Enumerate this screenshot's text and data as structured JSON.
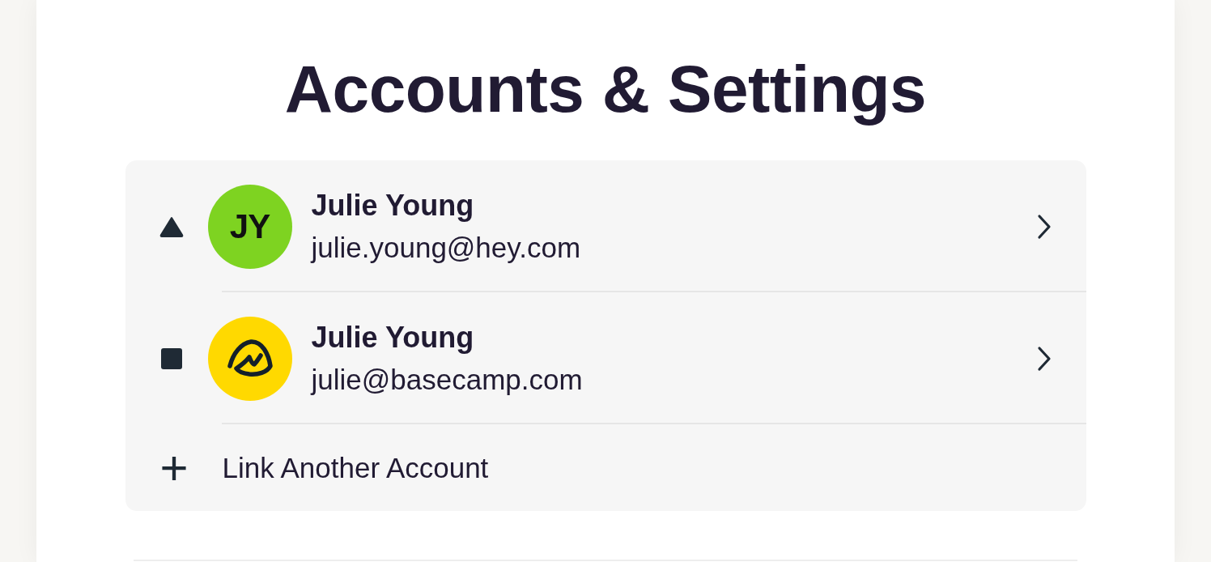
{
  "title": "Accounts & Settings",
  "accounts": [
    {
      "kind": "triangle",
      "avatar": {
        "kind": "initials",
        "text": "JY",
        "color": "#7ed321"
      },
      "name": "Julie Young",
      "email": "julie.young@hey.com"
    },
    {
      "kind": "square",
      "avatar": {
        "kind": "logo",
        "color": "#ffd900"
      },
      "name": "Julie Young",
      "email": "julie@basecamp.com"
    }
  ],
  "link_action": {
    "icon": "+",
    "label": "Link Another Account"
  }
}
